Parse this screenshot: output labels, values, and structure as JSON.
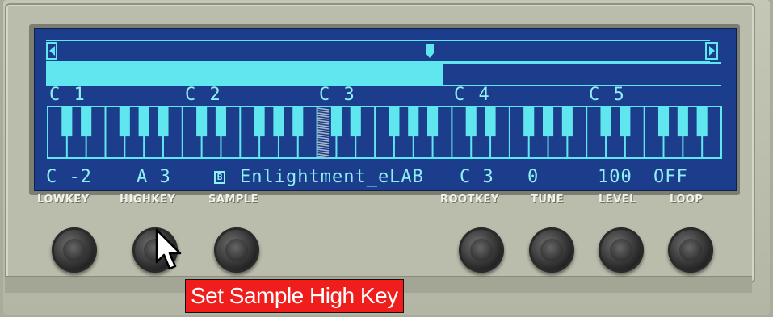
{
  "display": {
    "octaves": [
      "C 1",
      "C 2",
      "C 3",
      "C 4",
      "C 5"
    ],
    "params": {
      "lowkey": "C -2",
      "highkey": "A 3",
      "sample_icon": "B",
      "sample": "Enlightment_eLAB",
      "rootkey": "C 3",
      "tune": "0",
      "level": "100",
      "loop": "OFF"
    },
    "range_fill_fraction": 0.59
  },
  "knob_labels": {
    "lowkey": "LOWKEY",
    "highkey": "HIGHKEY",
    "sample": "SAMPLE",
    "rootkey": "ROOTKEY",
    "tune": "TUNE",
    "level": "LEVEL",
    "loop": "LOOP"
  },
  "tooltip": "Set Sample High Key",
  "icons": {
    "scroll_left": "triangle-left-icon",
    "scroll_right": "triangle-right-icon",
    "marker": "key-range-marker-icon",
    "cursor": "mouse-pointer-icon"
  },
  "colors": {
    "screen_bg": "#1b3d8c",
    "lcd_cyan": "#5fe6ee",
    "tooltip_bg": "#f01d1d",
    "panel": "#bbbdac"
  }
}
